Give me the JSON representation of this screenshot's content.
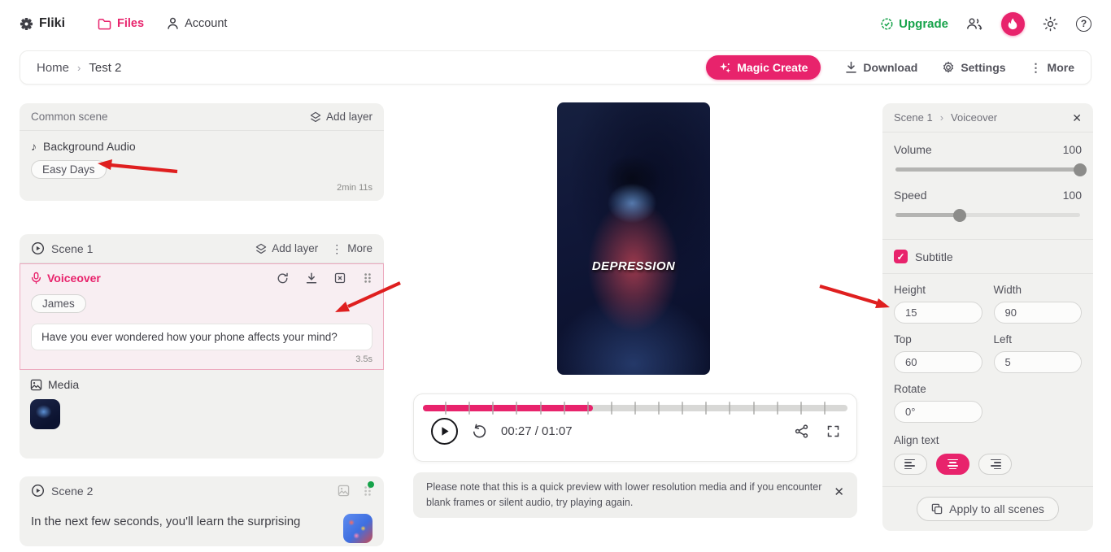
{
  "colors": {
    "accent": "#e8236c",
    "green": "#16a34a",
    "arrow": "#df1f1f",
    "dot": "#16a34a"
  },
  "topnav": {
    "brand": "Fliki",
    "files": "Files",
    "account": "Account",
    "upgrade": "Upgrade"
  },
  "toolbar": {
    "breadcrumb": [
      "Home",
      "Test 2"
    ],
    "magic_create": "Magic Create",
    "download": "Download",
    "settings": "Settings",
    "more": "More"
  },
  "common_scene": {
    "title": "Common scene",
    "add_layer": "Add layer",
    "background_audio": "Background Audio",
    "track": "Easy Days",
    "duration": "2min 11s"
  },
  "scene1": {
    "title": "Scene 1",
    "add_layer": "Add layer",
    "more": "More",
    "voiceover_label": "Voiceover",
    "voice": "James",
    "script": "Have you ever wondered how your phone affects your mind?",
    "duration": "3.5s",
    "media_label": "Media"
  },
  "scene2": {
    "title": "Scene 2",
    "script_preview": "In the next few seconds, you'll learn the surprising"
  },
  "preview": {
    "caption": "DEPRESSION",
    "time": "00:27 / 01:07",
    "progress_percent": 40,
    "tick_count": 17
  },
  "notice": "Please note that this is a quick preview with lower resolution media and if you encounter blank frames or silent audio, try playing again.",
  "inspector": {
    "scene": "Scene 1",
    "layer": "Voiceover",
    "volume_label": "Volume",
    "volume_value": "100",
    "volume_percent": 100,
    "speed_label": "Speed",
    "speed_value": "100",
    "speed_percent": 35,
    "subtitle_label": "Subtitle",
    "height_label": "Height",
    "height_value": "15",
    "width_label": "Width",
    "width_value": "90",
    "top_label": "Top",
    "top_value": "60",
    "left_label": "Left",
    "left_value": "5",
    "rotate_label": "Rotate",
    "rotate_value": "0°",
    "align_label": "Align text",
    "apply_all": "Apply to all scenes"
  }
}
